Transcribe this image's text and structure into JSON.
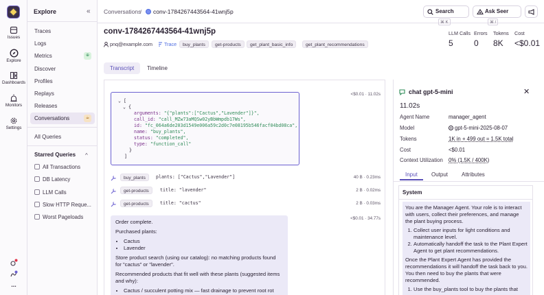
{
  "rail": {
    "items": [
      {
        "label": "Issues",
        "icon": "issues-icon"
      },
      {
        "label": "Explore",
        "icon": "compass-icon"
      },
      {
        "label": "Dashboards",
        "icon": "dashboard-icon"
      },
      {
        "label": "Monitors",
        "icon": "siren-icon"
      },
      {
        "label": "Settings",
        "icon": "gear-icon"
      }
    ],
    "more": "..."
  },
  "nav": {
    "title": "Explore",
    "collapse": "«",
    "items": [
      "Traces",
      "Logs",
      "Metrics",
      "Discover",
      "Profiles",
      "Replays",
      "Releases",
      "Conversations",
      "All Queries"
    ],
    "metrics_badge": "⊕",
    "conversations_badge": "☕",
    "starred_title": "Starred Queries",
    "starred_chevron": "^",
    "starred": [
      "All Transactions",
      "DB Latency",
      "LLM Calls",
      "Slow HTTP Reque...",
      "Worst Pageloads"
    ]
  },
  "header": {
    "crumb_parent": "Conversations",
    "crumb_sep": "/",
    "crumb_current": "conv-1784267443564-41wnj5p",
    "search_label": "Search",
    "search_kbd": "⌘ K",
    "seer_label": "Ask Seer",
    "seer_kbd": "⌘ /"
  },
  "page": {
    "title": "conv-1784267443564-41wnj5p",
    "user": "pnq@example.com",
    "trace": "Trace",
    "tags": [
      "buy_plants",
      "get-products",
      "get_plant_basic_info",
      "get_plant_recommendations"
    ],
    "stats": [
      {
        "label": "LLM Calls",
        "value": "5"
      },
      {
        "label": "Errors",
        "value": "0"
      },
      {
        "label": "Tokens",
        "value": "8K"
      },
      {
        "label": "Cost",
        "value": "<$0.01"
      }
    ],
    "tabs": [
      "Transcript",
      "Timeline"
    ]
  },
  "transcript": {
    "first_cost": "<$0.01 · 11.02s",
    "code": {
      "l1": "⌄ [",
      "l2": "⌄ {",
      "arguments_key": "arguments:",
      "arguments_val": "\"{\"plants\":[\"Cactus\",\"Lavender\"]}\",",
      "call_id_key": "call_id:",
      "call_id_val": "\"call_MZw73aMQSw02yBbWmpdb17Ws\",",
      "id_key": "id:",
      "id_val": "\"fc_064a6de203d1549e006a59c2d0c7e08195b546facf04bd08ca\",",
      "name_key": "name:",
      "name_val": "\"buy_plants\",",
      "status_key": "status:",
      "status_val": "\"completed\",",
      "type_key": "type:",
      "type_val": "\"function_call\"",
      "close_brace": "}",
      "close_bracket": "]"
    },
    "tools": [
      {
        "name": "buy_plants",
        "arg": "plants: [\"Cactus\",\"Lavender\"]",
        "meta": "40 B · 0.23ms"
      },
      {
        "name": "get-products",
        "arg": "title: \"lavender\"",
        "meta": "2 B · 0.02ms"
      },
      {
        "name": "get-products",
        "arg": "title: \"cactus\"",
        "meta": "2 B · 0.03ms"
      }
    ],
    "message_cost": "<$0.01 · 34.77s",
    "message": {
      "p1": "Order complete.",
      "p2": "Purchased plants:",
      "list1": [
        "Cactus",
        "Lavender"
      ],
      "p3": "Store product search (using our catalog): no matching products found for \"cactus\" or \"lavender\".",
      "p4": "Recommended products that fit well with these plants (suggested items and why):",
      "list2": [
        "Cactus / succulent potting mix — fast drainage to prevent root rot (essential for cacti)."
      ]
    }
  },
  "detail": {
    "title": "chat gpt-5-mini",
    "close": "✕",
    "duration": "11.02s",
    "rows": [
      {
        "k": "Agent Name",
        "v": "manager_agent"
      },
      {
        "k": "Model",
        "v": "gpt-5-mini-2025-08-07"
      },
      {
        "k": "Tokens",
        "v": "1K in + 499 out = 1.5K total"
      },
      {
        "k": "Cost",
        "v": "<$0.01"
      },
      {
        "k": "Context Utilization",
        "v": "0% (1.5K / 400K)"
      }
    ],
    "tabs": [
      "Input",
      "Output",
      "Attributes"
    ],
    "system_title": "System",
    "system": {
      "p1": "You are the Manager Agent. Your role is to interact with users, collect their preferences, and manage the plant buying process.",
      "ol1": [
        "Collect user inputs for light conditions and maintenance level.",
        "Automatically handoff the task to the Plant Expert Agent to get plant recommendations."
      ],
      "p2": "Once the Plant Expert Agent has provided the recommendations it will handoff the task back to you. You then need to buy the plants that were recommended.",
      "ol2": [
        "Use the buy_plants tool to buy the plants that"
      ]
    }
  }
}
